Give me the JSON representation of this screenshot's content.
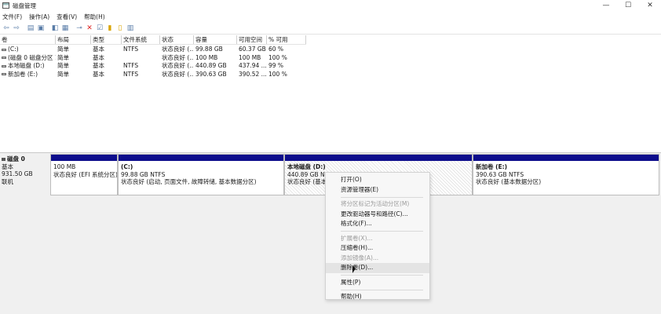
{
  "window": {
    "title": "磁盘管理",
    "controls": {
      "minimize": "—",
      "maximize": "☐",
      "close": "✕"
    }
  },
  "menu": [
    {
      "label": "文件(F)"
    },
    {
      "label": "操作(A)"
    },
    {
      "label": "查看(V)"
    },
    {
      "label": "帮助(H)"
    }
  ],
  "toolbar_icons": [
    "back-arrow-icon",
    "forward-arrow-icon",
    "list-view-icon",
    "help-icon",
    "properties-icon",
    "connect-icon",
    "delete-icon",
    "check-icon",
    "new-icon",
    "open-icon",
    "view-icon"
  ],
  "volume_table": {
    "columns": [
      "卷",
      "布局",
      "类型",
      "文件系统",
      "状态",
      "容量",
      "可用空间",
      "% 可用"
    ],
    "rows": [
      [
        "(C:)",
        "简单",
        "基本",
        "NTFS",
        "状态良好 (...",
        "99.88 GB",
        "60.37 GB",
        "60 %"
      ],
      [
        "(磁盘 0 磁盘分区 1)",
        "简单",
        "基本",
        "",
        "状态良好 (...",
        "100 MB",
        "100 MB",
        "100 %"
      ],
      [
        "本地磁盘 (D:)",
        "简单",
        "基本",
        "NTFS",
        "状态良好 (...",
        "440.89 GB",
        "437.94 ...",
        "99 %"
      ],
      [
        "新加卷 (E:)",
        "简单",
        "基本",
        "NTFS",
        "状态良好 (...",
        "390.63 GB",
        "390.52 ...",
        "100 %"
      ]
    ]
  },
  "disk": {
    "name": "磁盘 0",
    "type": "基本",
    "size": "931.50 GB",
    "status": "联机"
  },
  "partitions": [
    {
      "name": "",
      "size": "100 MB",
      "status": "状态良好 (EFI 系统分区)"
    },
    {
      "name": "(C:)",
      "size": "99.88 GB NTFS",
      "status": "状态良好 (启动, 页面文件, 故障转储, 基本数据分区)"
    },
    {
      "name": "本地磁盘 (D:)",
      "size": "440.89 GB NTFS",
      "status": "状态良好 (基本"
    },
    {
      "name": "新加卷 (E:)",
      "size": "390.63 GB NTFS",
      "status": "状态良好 (基本数据分区)"
    }
  ],
  "context_menu": {
    "items": [
      {
        "label": "打开(O)",
        "enabled": true
      },
      {
        "label": "资源管理器(E)",
        "enabled": true
      },
      {
        "label": "将分区标记为活动分区(M)",
        "enabled": false
      },
      {
        "label": "更改驱动器号和路径(C)...",
        "enabled": true
      },
      {
        "label": "格式化(F)...",
        "enabled": true
      },
      {
        "label": "扩展卷(X)...",
        "enabled": false
      },
      {
        "label": "压缩卷(H)...",
        "enabled": true
      },
      {
        "label": "添加镜像(A)...",
        "enabled": false
      },
      {
        "label": "删除卷(D)...",
        "enabled": true
      },
      {
        "label": "属性(P)",
        "enabled": true
      },
      {
        "label": "帮助(H)",
        "enabled": true
      }
    ]
  },
  "colors": {
    "partition_bar": "#0d0d8c",
    "delete_icon": "#dd2222"
  }
}
